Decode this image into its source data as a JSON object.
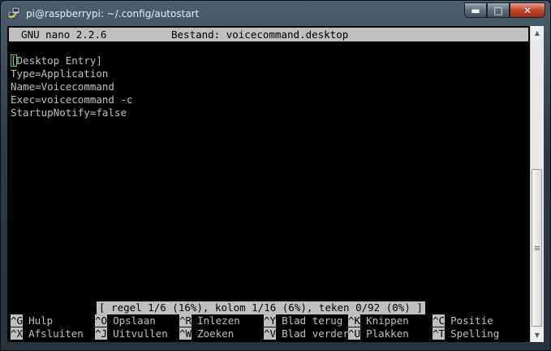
{
  "window": {
    "title": "pi@raspberrypi: ~/.config/autostart",
    "minimize_label": "▬",
    "maximize_label": "□",
    "close_label": "✕"
  },
  "nano": {
    "header_version": "  GNU nano 2.2.6",
    "header_file": "Bestand: voicecommand.desktop",
    "cursor_char": "[",
    "lines": [
      "Desktop Entry]",
      "Type=Application",
      "Name=Voicecommand",
      "Exec=voicecommand -c",
      "StartupNotify=false"
    ],
    "status": "[ regel 1/6 (16%), kolom 1/16 (6%), teken 0/92 (0%) ]",
    "shortcuts_row1": [
      {
        "key": "^G",
        "label": "Hulp"
      },
      {
        "key": "^O",
        "label": "Opslaan"
      },
      {
        "key": "^R",
        "label": "Inlezen"
      },
      {
        "key": "^Y",
        "label": "Blad terug"
      },
      {
        "key": "^K",
        "label": "Knippen"
      },
      {
        "key": "^C",
        "label": "Positie"
      }
    ],
    "shortcuts_row2": [
      {
        "key": "^X",
        "label": "Afsluiten"
      },
      {
        "key": "^J",
        "label": "Uitvullen"
      },
      {
        "key": "^W",
        "label": "Zoeken"
      },
      {
        "key": "^V",
        "label": "Blad verder"
      },
      {
        "key": "^U",
        "label": "Plakken"
      },
      {
        "key": "^T",
        "label": "Spelling"
      }
    ]
  },
  "scrollbar": {
    "up_arrow": "▲",
    "down_arrow": "▼",
    "position_fraction": 0.45
  }
}
